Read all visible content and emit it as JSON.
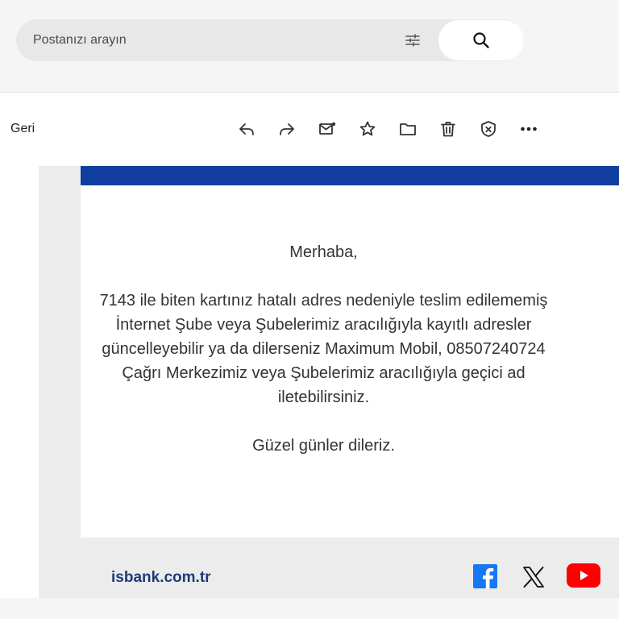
{
  "search": {
    "placeholder": "Postanızı arayın"
  },
  "toolbar": {
    "back_label": "Geri"
  },
  "email": {
    "greeting": "Merhaba,",
    "body_lines": [
      "7143 ile biten kartınız hatalı adres nedeniyle teslim edilememiş",
      "İnternet Şube veya Şubelerimiz aracılığıyla kayıtlı adresler",
      "güncelleyebilir ya da dilerseniz Maximum Mobil, 08507240724",
      "Çağrı Merkezimiz veya Şubelerimiz aracılığıyla geçici ad",
      "iletebilirsiniz."
    ],
    "closing": "Güzel günler dileriz.",
    "footer_link": "isbank.com.tr"
  },
  "colors": {
    "brand_blue": "#0f3e9e",
    "link_blue": "#1e3a78",
    "facebook": "#1877f2",
    "youtube": "#ff0000"
  },
  "icons": [
    "search-icon",
    "filter-icon",
    "reply-icon",
    "forward-icon",
    "mark-unread-icon",
    "star-icon",
    "folder-icon",
    "trash-icon",
    "spam-icon",
    "more-icon",
    "facebook-icon",
    "x-icon",
    "youtube-icon"
  ]
}
